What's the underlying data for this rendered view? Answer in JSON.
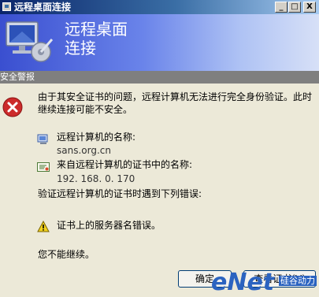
{
  "window": {
    "title": "远程桌面连接",
    "min_label": "_",
    "max_label": "□",
    "close_label": "X"
  },
  "banner": {
    "line1": "远程桌面",
    "line2": "连接"
  },
  "dialog": {
    "title": "安全警报",
    "message_line1": "由于其安全证书的问题，远程计算机无法进行完全身份验证。此时",
    "message_line2": "继续连接可能不安全。",
    "computer_name_label": "远程计算机的名称:",
    "computer_name_value": "sans.org.cn",
    "cert_name_label": "来自远程计算机的证书中的名称:",
    "cert_name_value": "192. 168. 0. 170",
    "errors_heading": "验证远程计算机的证书时遇到下列错误:",
    "error_item": "证书上的服务器名错误。",
    "cannot_continue": "您不能继续。",
    "ok_button": "确定",
    "view_cert_button": "查看证书(V)"
  },
  "watermark": {
    "brand": "eNet",
    "sub": "硅谷动力"
  },
  "colors": {
    "title_bar": "#0a246a",
    "banner_start": "#3a4fd0",
    "dialog_title": "#7f7f7f",
    "dialog_bg": "#ece9d8",
    "error_red": "#cc2b2b",
    "warning_yellow": "#f2d21e"
  },
  "icons": [
    "app-icon",
    "remote-desktop-logo-icon",
    "error-icon",
    "computer-icon",
    "certificate-icon",
    "warning-icon"
  ]
}
